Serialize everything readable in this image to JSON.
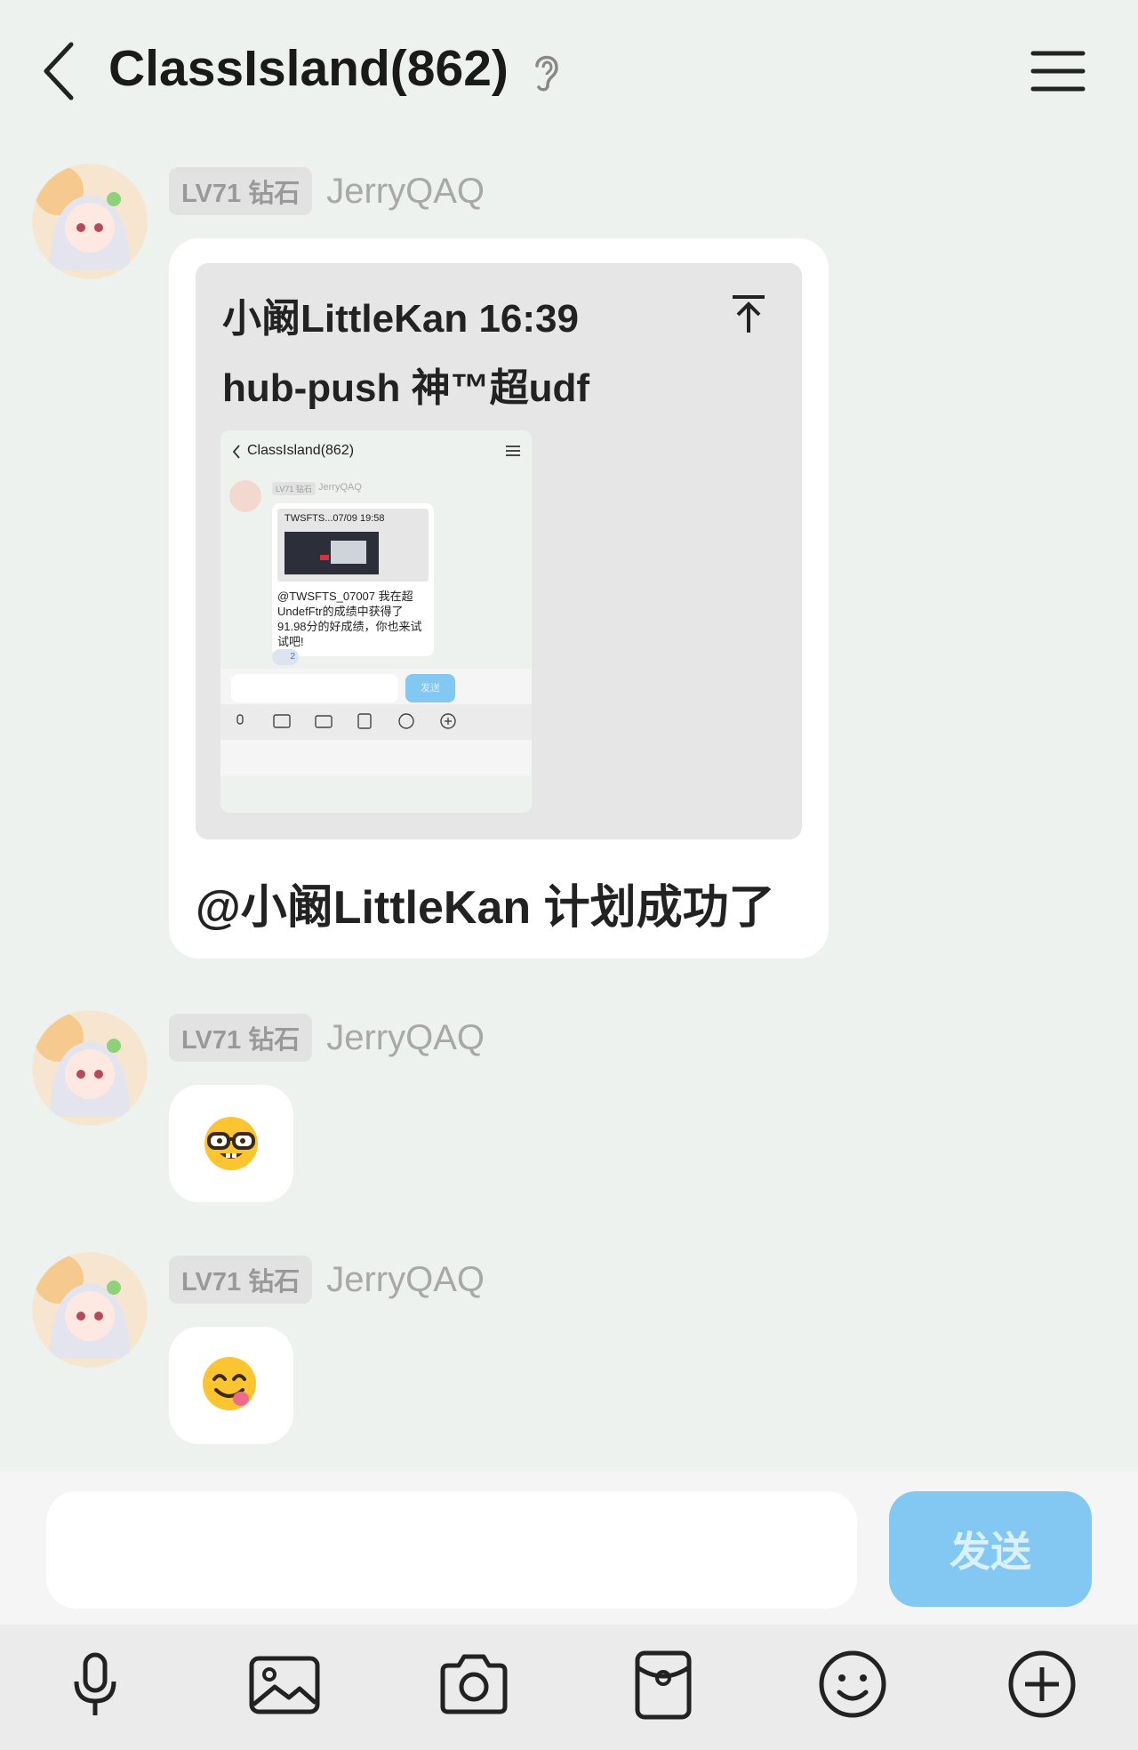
{
  "header": {
    "title": "ClassIsland(862)",
    "back_icon": "back-chevron-icon",
    "ear_icon": "ear-icon",
    "menu_icon": "menu-icon"
  },
  "messages": [
    {
      "badge": "LV71 钻石",
      "username": "JerryQAQ",
      "reply": {
        "author_time": "小阚LittleKan 16:39",
        "quoted": "hub-push 神™超udf",
        "arrow_icon": "jump-up-icon",
        "screenshot": {
          "title": "ClassIsland(862)",
          "badge": "LV71 钻石",
          "username": "JerryQAQ",
          "quote_head": "TWSFTS...07/09 19:58",
          "text_lines": [
            "@TWSFTS_07007 我在超",
            "UndefFtr的成绩中获得了",
            "91.98分的好成绩，你也来试",
            "试吧!"
          ],
          "reaction_count": "2",
          "send_label": "发送"
        }
      },
      "text": "@小阚LittleKan 计划成功了"
    },
    {
      "badge": "LV71 钻石",
      "username": "JerryQAQ",
      "emoji": "nerd-face-emoji"
    },
    {
      "badge": "LV71 钻石",
      "username": "JerryQAQ",
      "emoji": "yum-face-emoji"
    }
  ],
  "input": {
    "placeholder": "",
    "send_label": "发送"
  },
  "toolbar": [
    "microphone-icon",
    "image-icon",
    "camera-icon",
    "red-packet-icon",
    "emoji-icon",
    "plus-icon"
  ],
  "colors": {
    "background": "#eef2ef",
    "send_button": "#82c8f2",
    "bubble": "#ffffff"
  }
}
